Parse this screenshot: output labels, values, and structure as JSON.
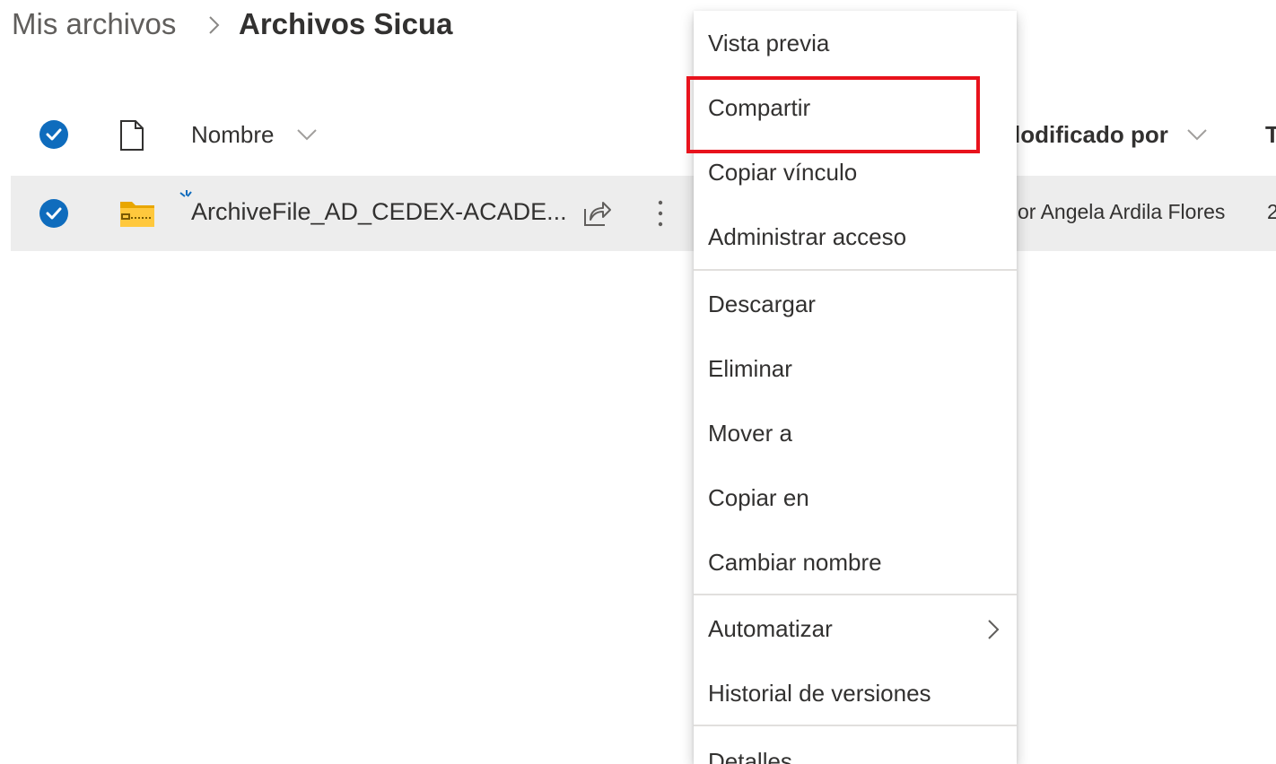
{
  "breadcrumb": {
    "parent": "Mis archivos",
    "current": "Archivos Sicua"
  },
  "columns": {
    "name": "Nombre",
    "modified_by": "lodificado por",
    "next_col_fragment": "T"
  },
  "file_row": {
    "name": "ArchiveFile_AD_CEDEX-ACADE...",
    "modified_by": "or Angela Ardila Flores",
    "next_col_fragment": "2",
    "selected": true
  },
  "context_menu": {
    "items": [
      {
        "label": "Vista previa"
      },
      {
        "label": "Compartir",
        "highlighted": true
      },
      {
        "label": "Copiar vínculo"
      },
      {
        "label": "Administrar acceso"
      },
      {
        "label": "Descargar"
      },
      {
        "label": "Eliminar"
      },
      {
        "label": "Mover a"
      },
      {
        "label": "Copiar en"
      },
      {
        "label": "Cambiar nombre"
      },
      {
        "label": "Automatizar",
        "has_submenu": true
      },
      {
        "label": "Historial de versiones"
      },
      {
        "label": "Detalles"
      }
    ]
  },
  "colors": {
    "accent": "#0f6cbd",
    "selected_row_bg": "#ededed",
    "highlight_border": "#e8121c",
    "zip_folder": "#ffb900"
  },
  "icons": {
    "breadcrumb_separator": "chevron-right-icon",
    "select_all": "checkmark-circle-icon",
    "file_type": "document-icon",
    "sort": "chevron-down-icon",
    "zip": "zip-folder-icon",
    "new": "new-item-sparkle-icon",
    "share": "share-icon",
    "more": "more-vertical-icon",
    "submenu": "chevron-right-icon"
  }
}
